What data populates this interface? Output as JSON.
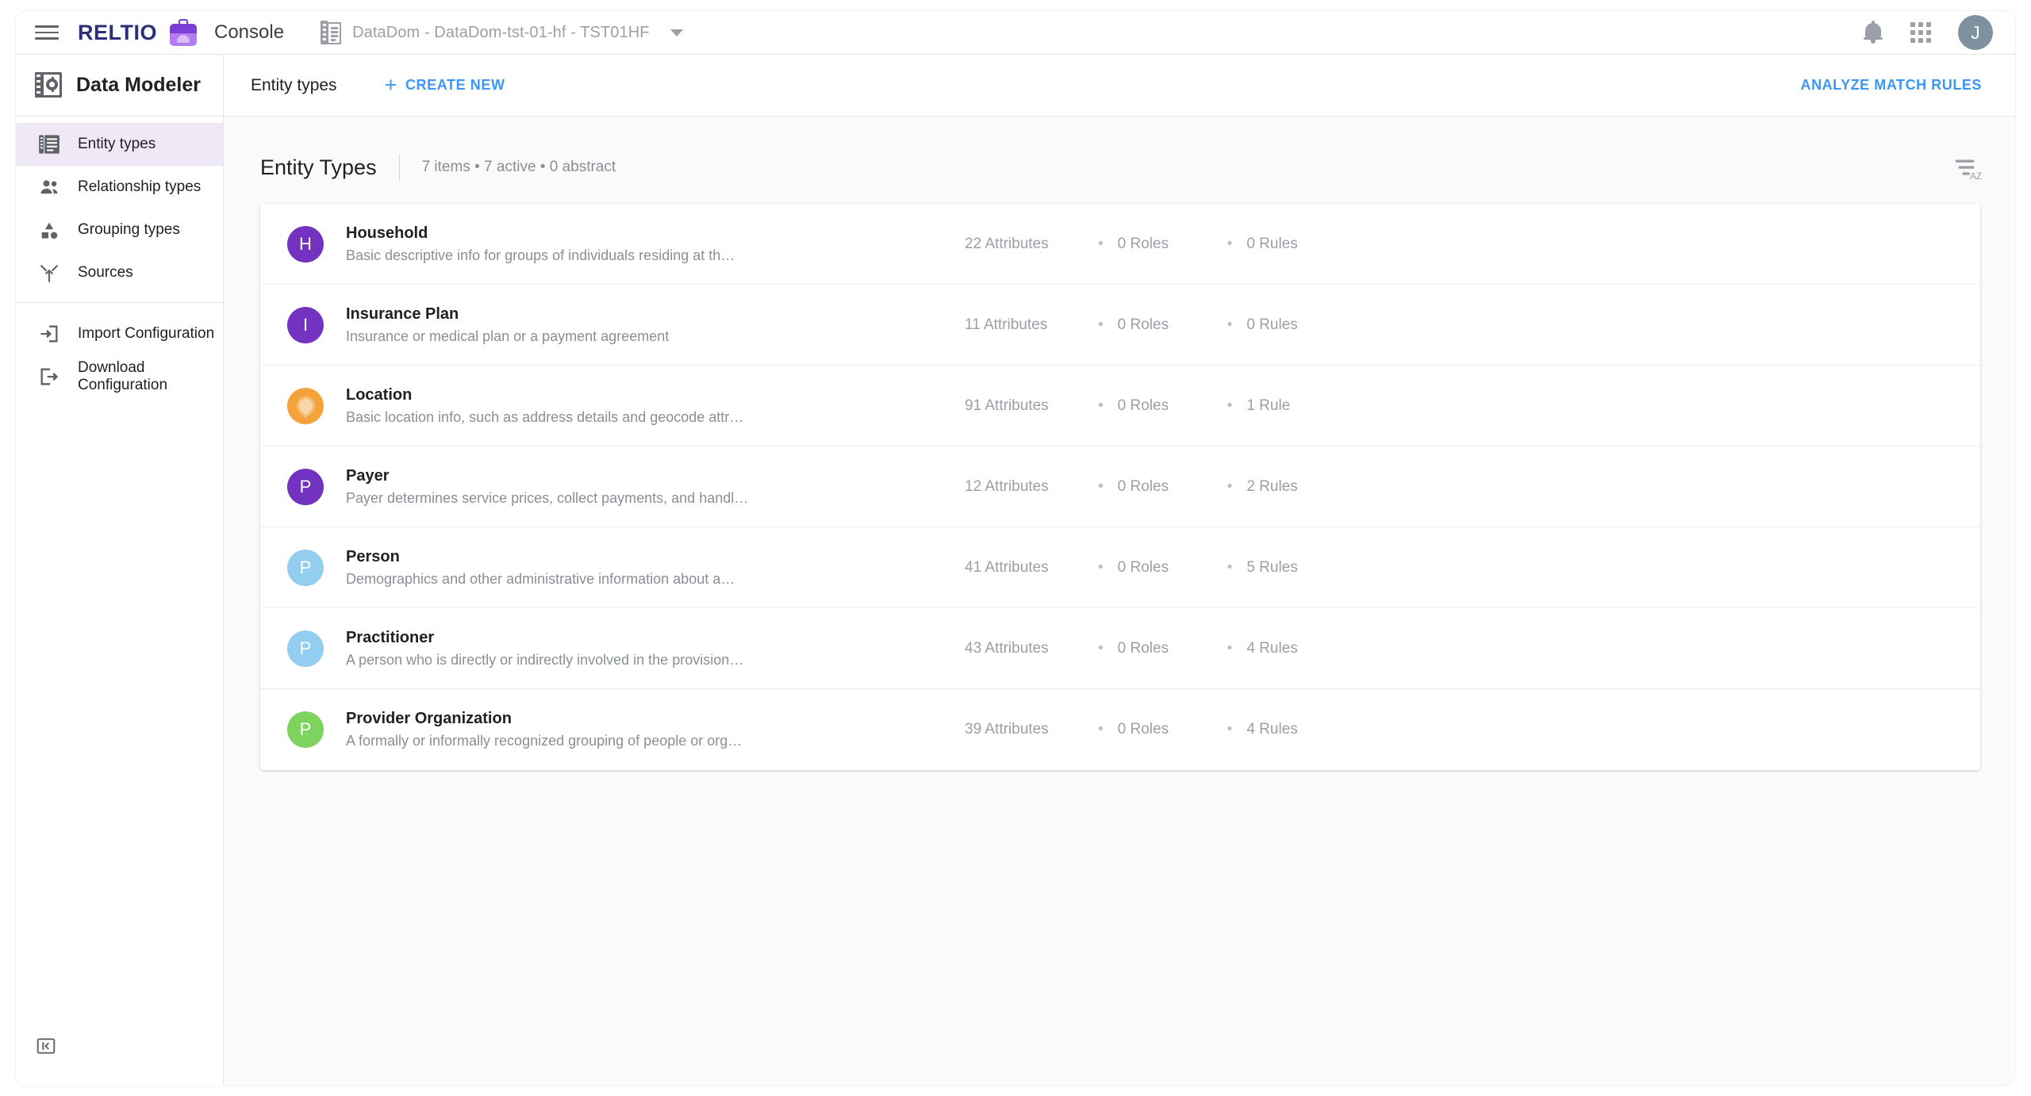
{
  "topbar": {
    "menu_icon": "hamburger-icon",
    "brand": "RELTIO",
    "product": "Console",
    "tenant": "DataDom - DataDom-tst-01-hf - TST01HF",
    "tenant_icon": "tenant-building-icon",
    "caret_icon": "chevron-down-icon",
    "notifications_icon": "bell-icon",
    "apps_icon": "apps-grid-icon",
    "avatar_initial": "J"
  },
  "sidebar": {
    "title": "Data Modeler",
    "title_icon": "data-modeler-icon",
    "items": [
      {
        "label": "Entity types",
        "icon": "entity-types-icon",
        "active": true
      },
      {
        "label": "Relationship types",
        "icon": "relationship-types-icon",
        "active": false
      },
      {
        "label": "Grouping types",
        "icon": "grouping-types-icon",
        "active": false
      },
      {
        "label": "Sources",
        "icon": "sources-icon",
        "active": false
      }
    ],
    "secondary_items": [
      {
        "label": "Import Configuration",
        "icon": "import-configuration-icon"
      },
      {
        "label": "Download Configuration",
        "icon": "download-configuration-icon"
      }
    ],
    "collapse_icon": "collapse-sidebar-icon"
  },
  "content_header": {
    "tab_label": "Entity types",
    "create_new_label": "CREATE NEW",
    "create_new_icon": "plus-icon",
    "analyze_label": "ANALYZE MATCH RULES"
  },
  "panel": {
    "title": "Entity Types",
    "meta": "7 items • 7 active • 0 abstract",
    "sort_icon": "sort-az-icon"
  },
  "colors": {
    "accent_link": "#3b97f3",
    "active_nav_bg": "#efe8f7",
    "brand": "#2b2f7a"
  },
  "entity_types": [
    {
      "initial": "H",
      "color": "#7432c0",
      "name": "Household",
      "description": "Basic descriptive info for groups of individuals residing at th…",
      "attributes": "22 Attributes",
      "roles": "0 Roles",
      "rules": "0 Rules"
    },
    {
      "initial": "I",
      "color": "#7432c0",
      "name": "Insurance Plan",
      "description": "Insurance or medical plan or a payment agreement",
      "attributes": "11 Attributes",
      "roles": "0 Roles",
      "rules": "0 Rules"
    },
    {
      "initial": "",
      "color": "#f4a23c",
      "name": "Location",
      "description": "Basic location info, such as address details and geocode attr…",
      "attributes": "91 Attributes",
      "roles": "0 Roles",
      "rules": "1 Rule"
    },
    {
      "initial": "P",
      "color": "#7432c0",
      "name": "Payer",
      "description": "Payer determines service prices, collect payments, and handl…",
      "attributes": "12 Attributes",
      "roles": "0 Roles",
      "rules": "2 Rules"
    },
    {
      "initial": "P",
      "color": "#93cdf0",
      "name": "Person",
      "description": "Demographics and other administrative information about a…",
      "attributes": "41 Attributes",
      "roles": "0 Roles",
      "rules": "5 Rules"
    },
    {
      "initial": "P",
      "color": "#93cdf0",
      "name": "Practitioner",
      "description": "A person who is directly or indirectly involved in the provision…",
      "attributes": "43 Attributes",
      "roles": "0 Roles",
      "rules": "4 Rules"
    },
    {
      "initial": "P",
      "color": "#7ed35e",
      "name": "Provider Organization",
      "description": "A formally or informally recognized grouping of people or org…",
      "attributes": "39 Attributes",
      "roles": "0 Roles",
      "rules": "4 Rules"
    }
  ]
}
